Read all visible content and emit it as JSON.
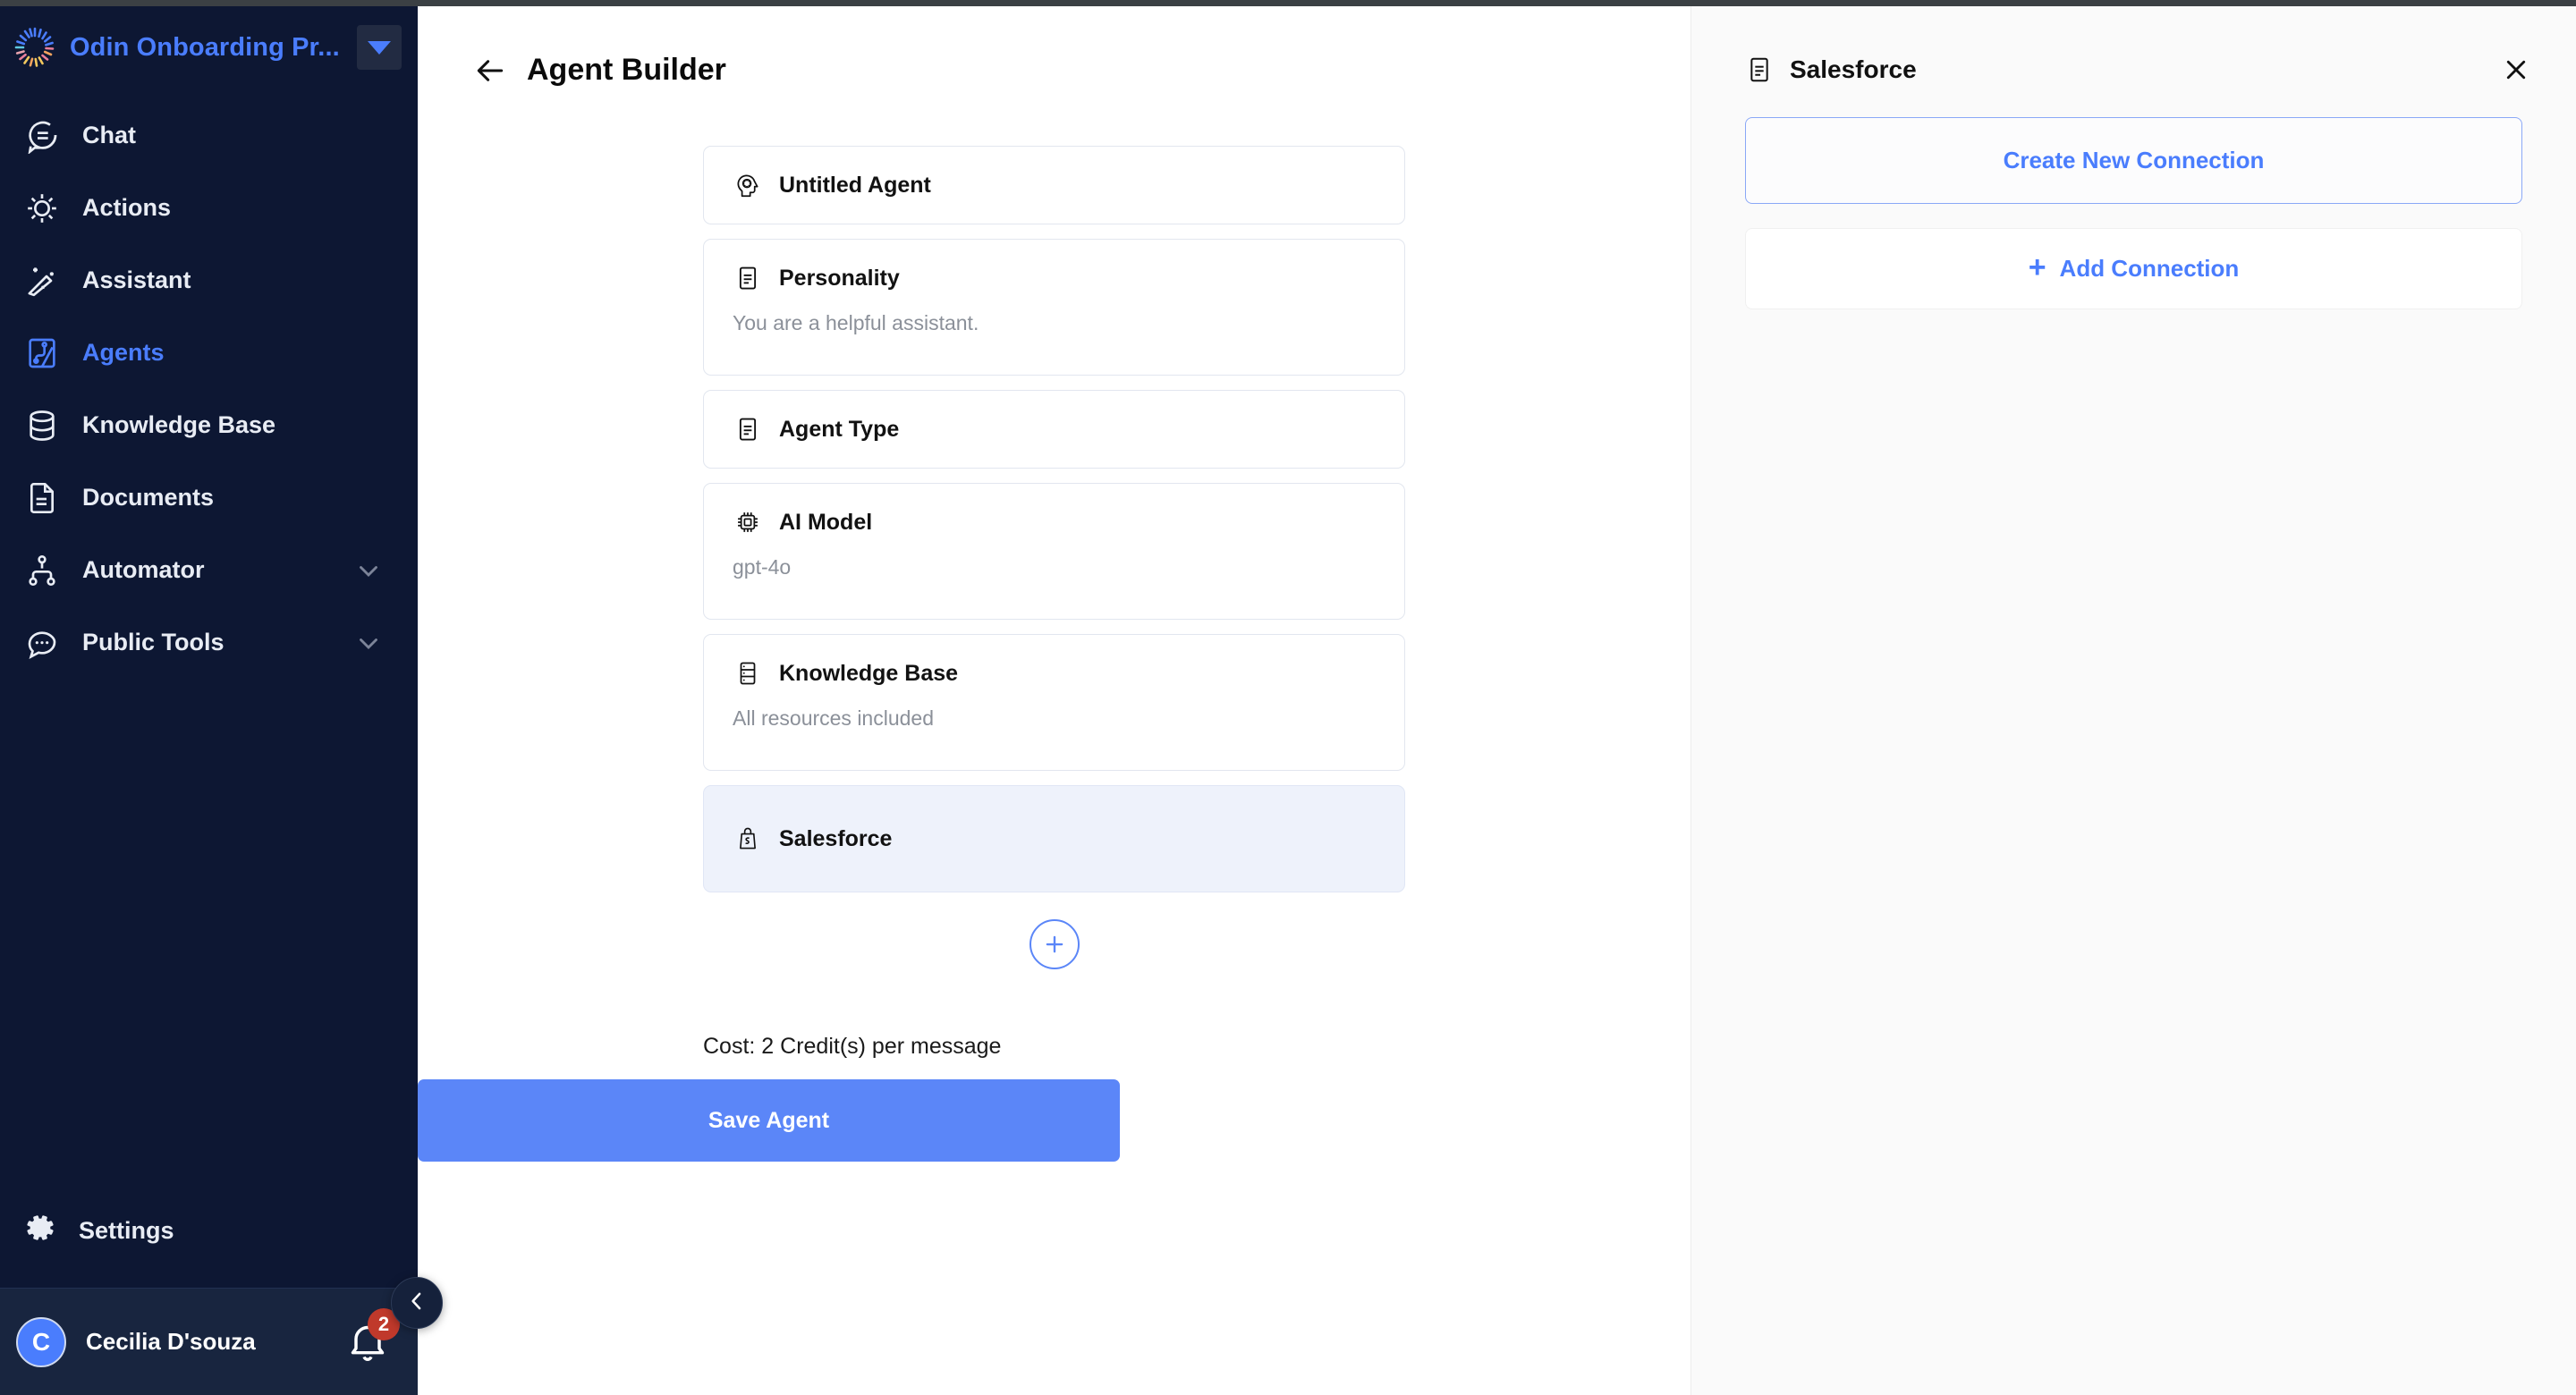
{
  "sidebar": {
    "brand": {
      "name": "Odin Onboarding Pr...",
      "logo_icon": "burst-logo",
      "caret_icon": "caret-down-icon"
    },
    "items": [
      {
        "label": "Chat",
        "icon": "chat-bubble-icon",
        "active": false,
        "expandable": false
      },
      {
        "label": "Actions",
        "icon": "sun-gear-icon",
        "active": false,
        "expandable": false
      },
      {
        "label": "Assistant",
        "icon": "magic-wand-icon",
        "active": false,
        "expandable": false
      },
      {
        "label": "Agents",
        "icon": "agents-node-icon",
        "active": true,
        "expandable": false
      },
      {
        "label": "Knowledge Base",
        "icon": "database-icon",
        "active": false,
        "expandable": false
      },
      {
        "label": "Documents",
        "icon": "document-icon",
        "active": false,
        "expandable": false
      },
      {
        "label": "Automator",
        "icon": "sitemap-icon",
        "active": false,
        "expandable": true
      },
      {
        "label": "Public Tools",
        "icon": "chat-dots-icon",
        "active": false,
        "expandable": true
      }
    ],
    "settings": {
      "label": "Settings",
      "icon": "gear-icon"
    },
    "user": {
      "initial": "C",
      "name": "Cecilia D'souza",
      "bell_icon": "bell-icon",
      "notification_count": "2"
    },
    "collapse_icon": "chevron-left-icon"
  },
  "main": {
    "back_icon": "arrow-left-icon",
    "title": "Agent Builder",
    "cards": [
      {
        "title": "Untitled Agent",
        "icon": "agent-head-icon",
        "sub": "",
        "selected": false
      },
      {
        "title": "Personality",
        "icon": "list-card-icon",
        "sub": "You are a helpful assistant.",
        "selected": false
      },
      {
        "title": "Agent Type",
        "icon": "list-card-icon",
        "sub": "",
        "selected": false
      },
      {
        "title": "AI Model",
        "icon": "ai-chip-icon",
        "sub": "gpt-4o",
        "selected": false
      },
      {
        "title": "Knowledge Base",
        "icon": "database-card-icon",
        "sub": "All resources included",
        "selected": false
      },
      {
        "title": "Salesforce",
        "icon": "salesforce-bag-icon",
        "sub": "",
        "selected": true
      }
    ],
    "add_block_icon": "plus-circle-icon",
    "cost_text": "Cost: 2 Credit(s) per message",
    "save_label": "Save Agent"
  },
  "panel": {
    "icon": "list-card-icon",
    "title": "Salesforce",
    "close_icon": "close-icon",
    "create_connection_label": "Create New Connection",
    "add_connection_label": "Add Connection",
    "add_connection_icon": "plus-icon"
  },
  "colors": {
    "sidebar_bg": "#0d1733",
    "accent_blue": "#4a7dfd",
    "save_button": "#5b86f8",
    "panel_bg": "#fafafa",
    "selected_card": "#eef2fb",
    "badge_red": "#c0392b"
  }
}
